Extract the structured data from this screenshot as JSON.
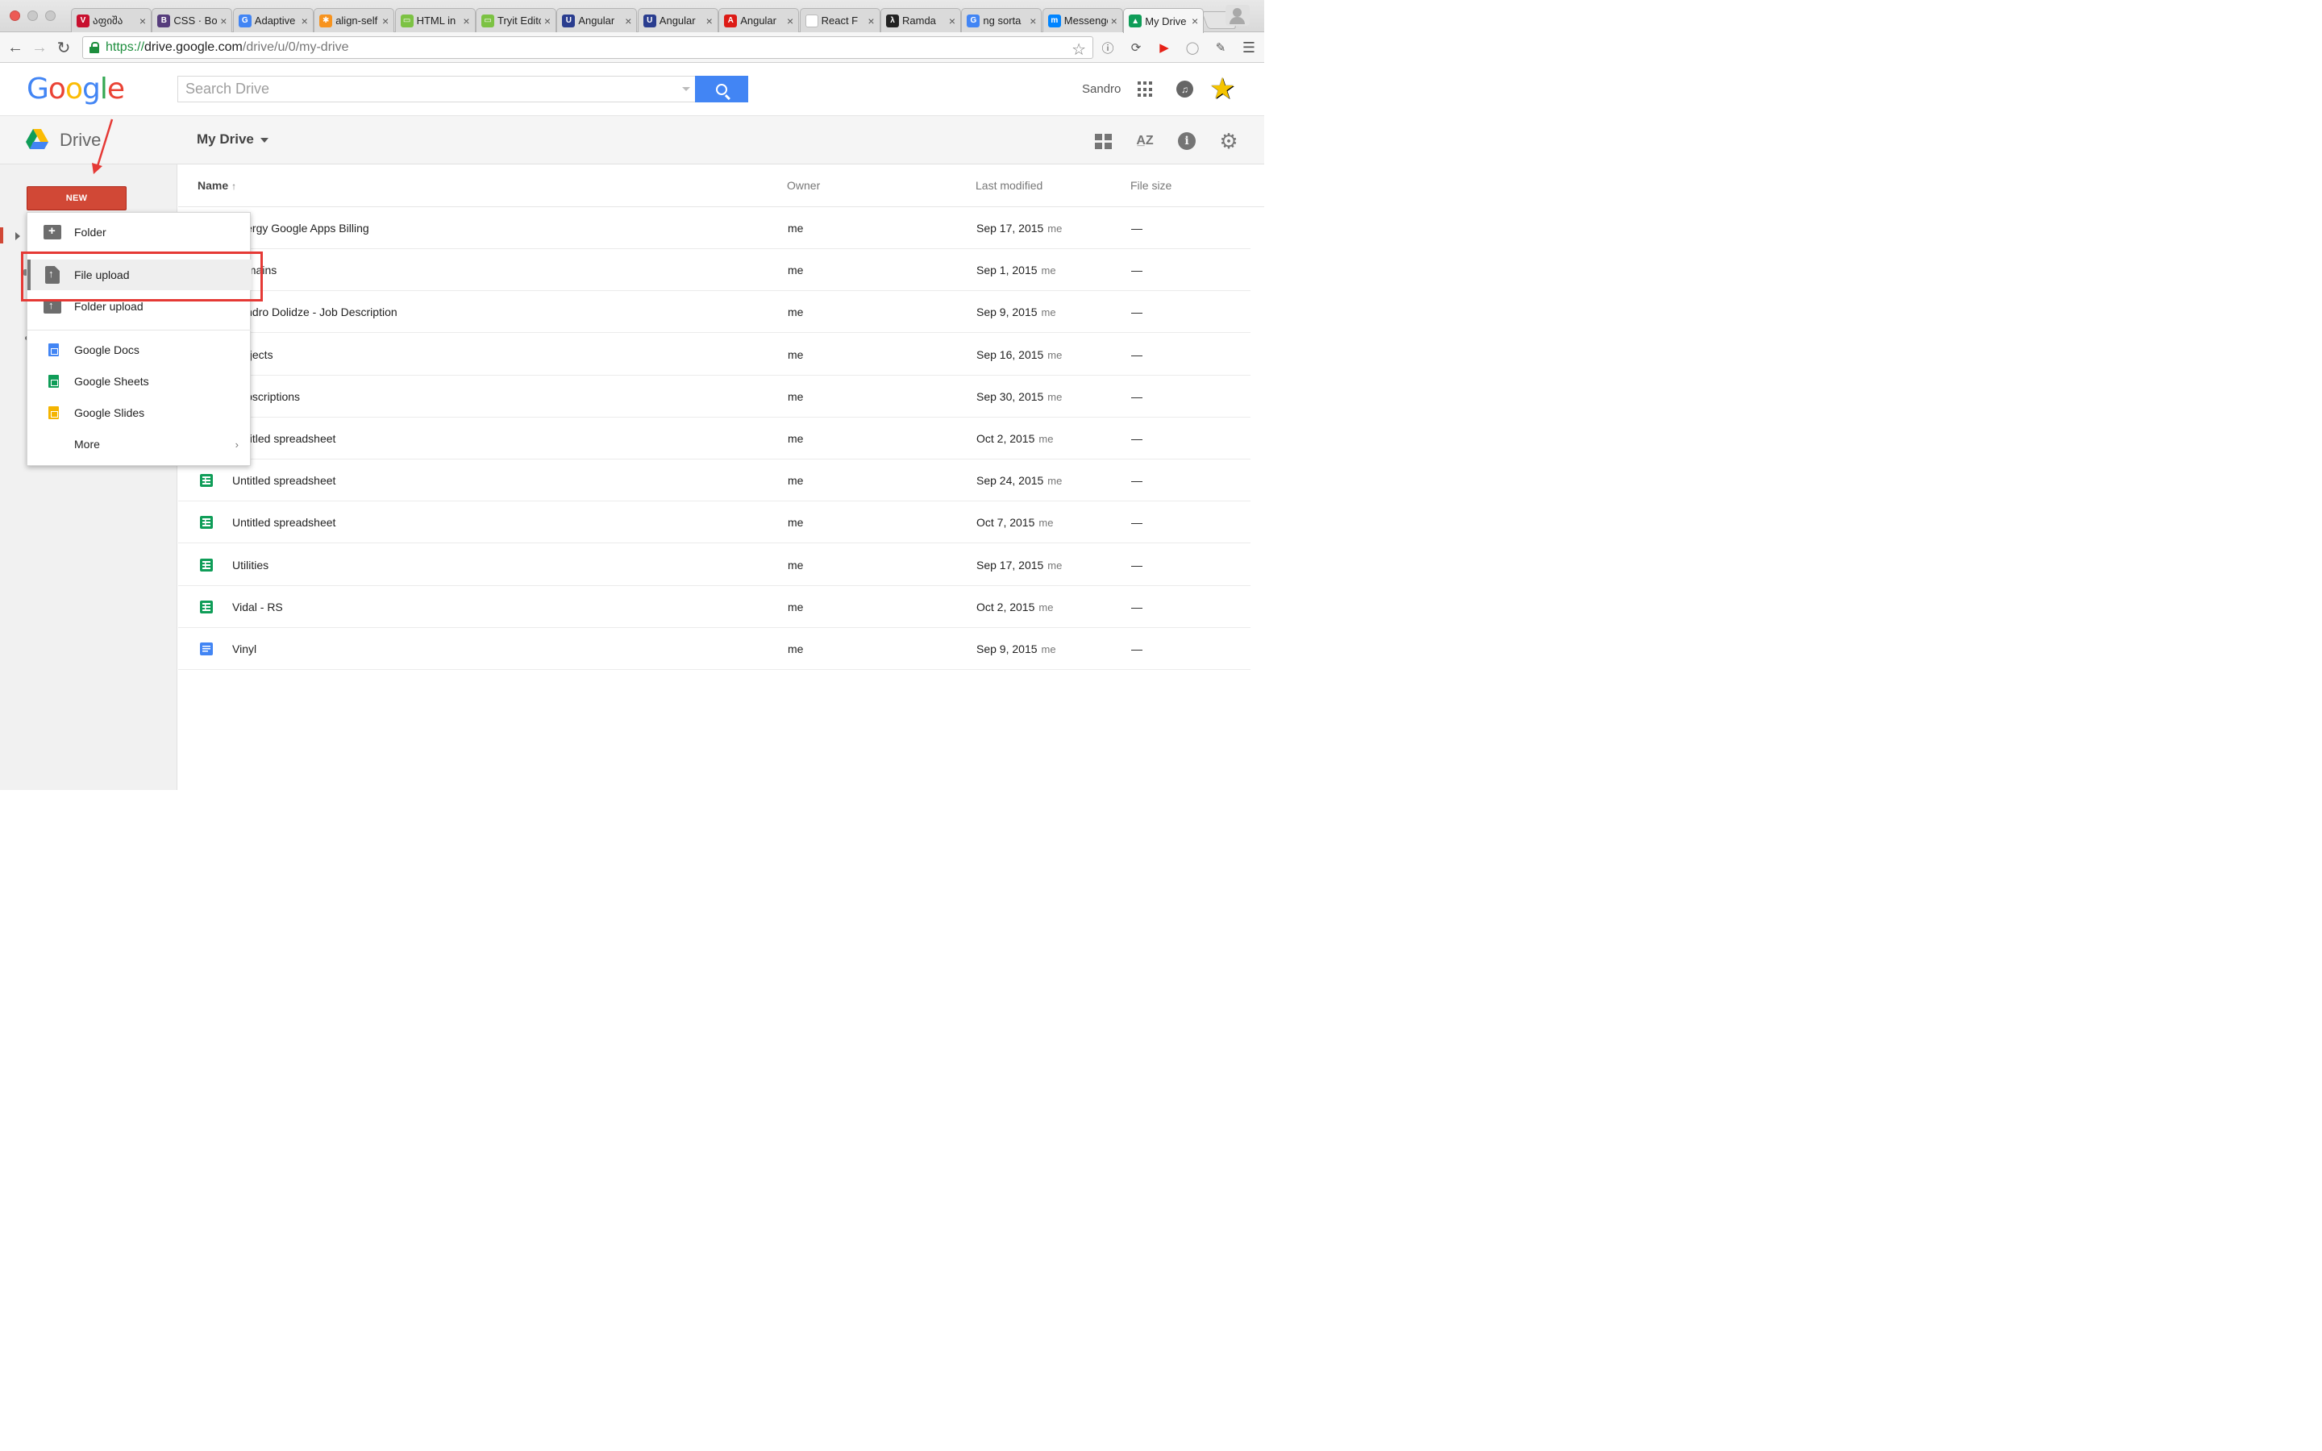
{
  "browser": {
    "tabs": [
      {
        "title": "აფიშა",
        "favicon": "V",
        "favicon_color": "#c8102e"
      },
      {
        "title": "CSS · Bootstrap",
        "favicon": "B",
        "favicon_color": "#563d7c"
      },
      {
        "title": "Adaptive",
        "favicon": "G",
        "favicon_color": "#4285f4"
      },
      {
        "title": "align-self",
        "favicon": "✱",
        "favicon_color": "#f7931e"
      },
      {
        "title": "HTML in",
        "favicon": "▭",
        "favicon_color": "#7cc243"
      },
      {
        "title": "Tryit Editor",
        "favicon": "▭",
        "favicon_color": "#7cc243"
      },
      {
        "title": "Angular",
        "favicon": "U",
        "favicon_color": "#2a3d8f"
      },
      {
        "title": "Angular",
        "favicon": "U",
        "favicon_color": "#2a3d8f"
      },
      {
        "title": "Angular",
        "favicon": "A",
        "favicon_color": "#dd1b16"
      },
      {
        "title": "React F",
        "favicon": "",
        "favicon_color": "#ffffff"
      },
      {
        "title": "Ramda",
        "favicon": "λ",
        "favicon_color": "#222222"
      },
      {
        "title": "ng sorta",
        "favicon": "G",
        "favicon_color": "#4285f4"
      },
      {
        "title": "Messenger",
        "favicon": "m",
        "favicon_color": "#0084ff"
      },
      {
        "title": "My Drive",
        "favicon": "▲",
        "favicon_color": "#0f9d58"
      }
    ],
    "url_scheme": "https://",
    "url_host": "drive.google.com",
    "url_path": "/drive/u/0/my-drive"
  },
  "google": {
    "logo_letters": [
      {
        "ch": "G",
        "color": "#4285f4"
      },
      {
        "ch": "o",
        "color": "#ea4335"
      },
      {
        "ch": "o",
        "color": "#fbbc05"
      },
      {
        "ch": "g",
        "color": "#4285f4"
      },
      {
        "ch": "l",
        "color": "#34a853"
      },
      {
        "ch": "e",
        "color": "#ea4335"
      }
    ],
    "search_placeholder": "Search Drive",
    "user_name": "Sandro"
  },
  "drive": {
    "app_title": "Drive",
    "location": "My Drive",
    "new_label": "NEW"
  },
  "columns": {
    "name": "Name",
    "name_sort_arrow": "↑",
    "owner": "Owner",
    "modified": "Last modified",
    "size": "File size"
  },
  "files": [
    {
      "name": "Energy Google Apps Billing",
      "icon": "sheet",
      "owner": "me",
      "modified": "Sep 17, 2015",
      "by": "me",
      "size": "—"
    },
    {
      "name": "Domains",
      "icon": "sheet",
      "owner": "me",
      "modified": "Sep 1, 2015",
      "by": "me",
      "size": "—"
    },
    {
      "name": "Sandro Dolidze - Job Description",
      "icon": "doc",
      "owner": "me",
      "modified": "Sep 9, 2015",
      "by": "me",
      "size": "—"
    },
    {
      "name": "Projects",
      "icon": "sheet",
      "owner": "me",
      "modified": "Sep 16, 2015",
      "by": "me",
      "size": "—"
    },
    {
      "name": "Subscriptions",
      "icon": "sheet",
      "owner": "me",
      "modified": "Sep 30, 2015",
      "by": "me",
      "size": "—"
    },
    {
      "name": "Untitled spreadsheet",
      "icon": "sheet",
      "owner": "me",
      "modified": "Oct 2, 2015",
      "by": "me",
      "size": "—"
    },
    {
      "name": "Untitled spreadsheet",
      "icon": "sheet",
      "owner": "me",
      "modified": "Sep 24, 2015",
      "by": "me",
      "size": "—"
    },
    {
      "name": "Untitled spreadsheet",
      "icon": "sheet",
      "owner": "me",
      "modified": "Oct 7, 2015",
      "by": "me",
      "size": "—"
    },
    {
      "name": "Utilities",
      "icon": "sheet",
      "owner": "me",
      "modified": "Sep 17, 2015",
      "by": "me",
      "size": "—"
    },
    {
      "name": "Vidal - RS",
      "icon": "sheet",
      "owner": "me",
      "modified": "Oct 2, 2015",
      "by": "me",
      "size": "—"
    },
    {
      "name": "Vinyl",
      "icon": "doc",
      "owner": "me",
      "modified": "Sep 9, 2015",
      "by": "me",
      "size": "—"
    }
  ],
  "new_menu": {
    "folder": "Folder",
    "file_upload": "File upload",
    "folder_upload": "Folder upload",
    "docs": "Google Docs",
    "sheets": "Google Sheets",
    "slides": "Google Slides",
    "more": "More"
  },
  "colors": {
    "new_button": "#d14836",
    "search_button": "#4285f4",
    "annotation": "#e53935",
    "sheets_green": "#0f9d58",
    "docs_blue": "#4285f4"
  }
}
